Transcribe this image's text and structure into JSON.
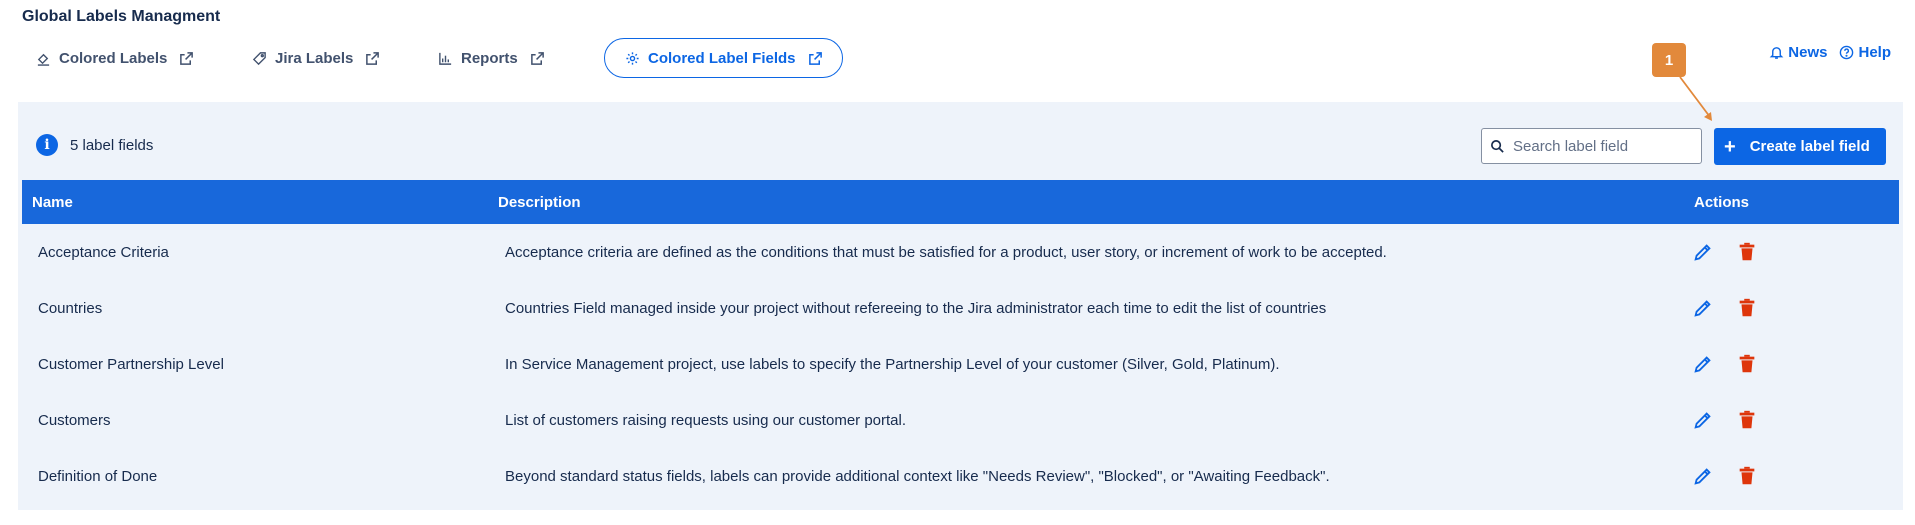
{
  "page": {
    "title": "Global Labels Managment"
  },
  "nav": {
    "tabs": [
      {
        "label": "Colored Labels",
        "icon": "paint-bucket-icon"
      },
      {
        "label": "Jira Labels",
        "icon": "tag-icon"
      },
      {
        "label": "Reports",
        "icon": "bar-chart-icon"
      },
      {
        "label": "Colored Label Fields",
        "icon": "gear-icon",
        "active": true
      }
    ]
  },
  "header": {
    "news_label": "News",
    "help_label": "Help"
  },
  "toolbar": {
    "count_label": "5 label fields",
    "search_placeholder": "Search label field",
    "create_label": "Create label field"
  },
  "annotation": {
    "badge": "1"
  },
  "table": {
    "columns": {
      "name": "Name",
      "description": "Description",
      "actions": "Actions"
    },
    "rows": [
      {
        "name": "Acceptance Criteria",
        "description": "Acceptance criteria are defined as the conditions that must be satisfied for a product, user story, or increment of work to be accepted."
      },
      {
        "name": "Countries",
        "description": "Countries Field managed inside your project without refereeing to the Jira administrator each time to edit the list of countries"
      },
      {
        "name": "Customer Partnership Level",
        "description": "In Service Management project, use labels to specify the Partnership Level of your customer (Silver, Gold, Platinum)."
      },
      {
        "name": "Customers",
        "description": "List of customers raising requests using our customer portal."
      },
      {
        "name": "Definition of Done",
        "description": "Beyond standard status fields, labels can provide additional context like \"Needs Review\", \"Blocked\", or \"Awaiting Feedback\"."
      }
    ]
  },
  "colors": {
    "accent": "#0c66e4",
    "table_header": "#1868db",
    "panel_bg": "#eef3fa",
    "delete": "#de350b",
    "annotation": "#e2893b"
  }
}
